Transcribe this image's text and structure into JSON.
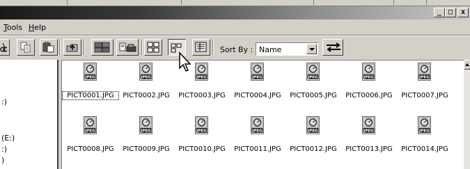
{
  "window": {
    "minimize_glyph": "_",
    "maximize_glyph": "□",
    "close_glyph": "x"
  },
  "menu": {
    "tools_prefix": "T",
    "tools_rest": "ools",
    "help_prefix": "H",
    "help_rest": "elp"
  },
  "toolbar": {
    "sort_label": "Sort By :",
    "sort_value": "Name",
    "active_view": "small-icons",
    "buttons": [
      "cut-icon",
      "copy-icon",
      "paste-icon",
      "folder-up-icon",
      "slideshow-icon",
      "print-icon",
      "large-icons-view-icon",
      "small-icons-view-icon",
      "details-view-icon",
      "sort-direction-icon"
    ]
  },
  "tree": {
    "frag1": ":)",
    "frag2": "(E:)",
    "frag3": ":)",
    "frag4": ")"
  },
  "files": {
    "icon_label": "JPEG",
    "row1": [
      {
        "name": "PICT0001.JPG",
        "selected": true
      },
      {
        "name": "PICT0002.JPG"
      },
      {
        "name": "PICT0003.JPG"
      },
      {
        "name": "PICT0004.JPG"
      },
      {
        "name": "PICT0005.JPG"
      },
      {
        "name": "PICT0006.JPG"
      },
      {
        "name": "PICT0007.JPG"
      }
    ],
    "row2": [
      {
        "name": "PICT0008.JPG"
      },
      {
        "name": "PICT0009.JPG"
      },
      {
        "name": "PICT0010.JPG"
      },
      {
        "name": "PICT0011.JPG"
      },
      {
        "name": "PICT0012.JPG"
      },
      {
        "name": "PICT0013.JPG"
      },
      {
        "name": "PICT0014.JPG"
      }
    ]
  },
  "colors": {
    "face": "#d4d0c8",
    "title_dark": "#1a1a1a",
    "title_light": "#c8c8c8"
  }
}
